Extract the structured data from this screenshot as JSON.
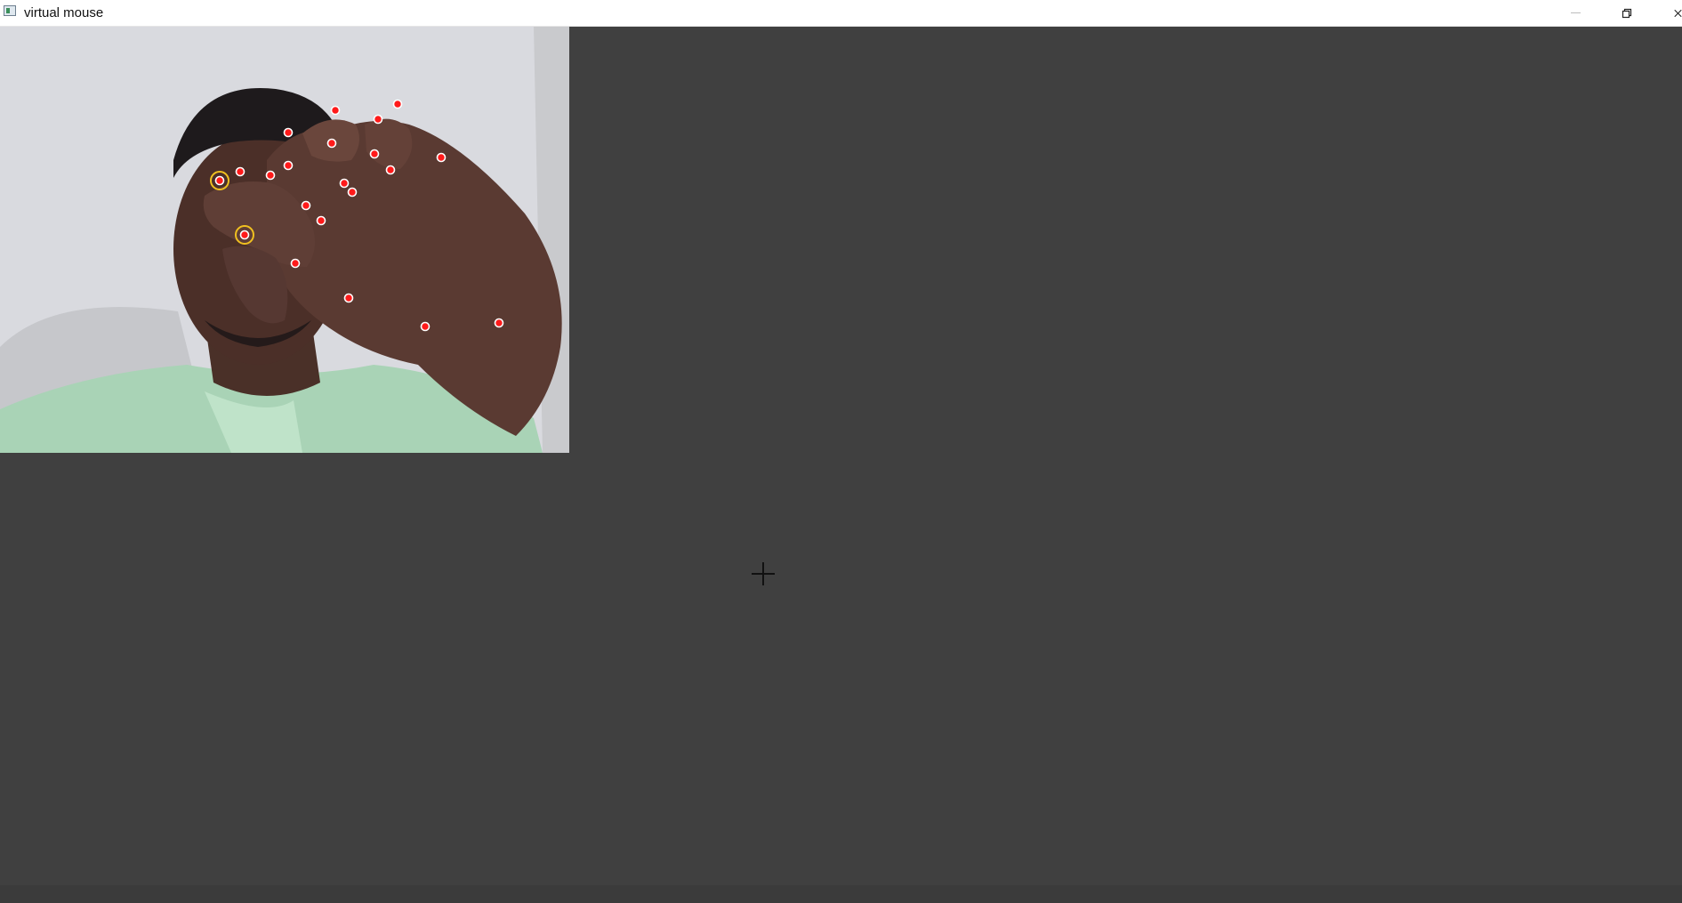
{
  "window": {
    "title": "virtual mouse",
    "icons": {
      "app": "app-window-icon",
      "minimize": "minimize-icon",
      "maximize": "restore-icon",
      "close": "close-icon"
    }
  },
  "camera": {
    "description_icon": "webcam-feed",
    "landmark_color": "#ff0000",
    "highlight_color": "#f0c020",
    "landmark_count": 21,
    "highlighted_landmarks": 2
  },
  "colors": {
    "canvas_background": "#404040",
    "titlebar_background": "#ffffff"
  }
}
